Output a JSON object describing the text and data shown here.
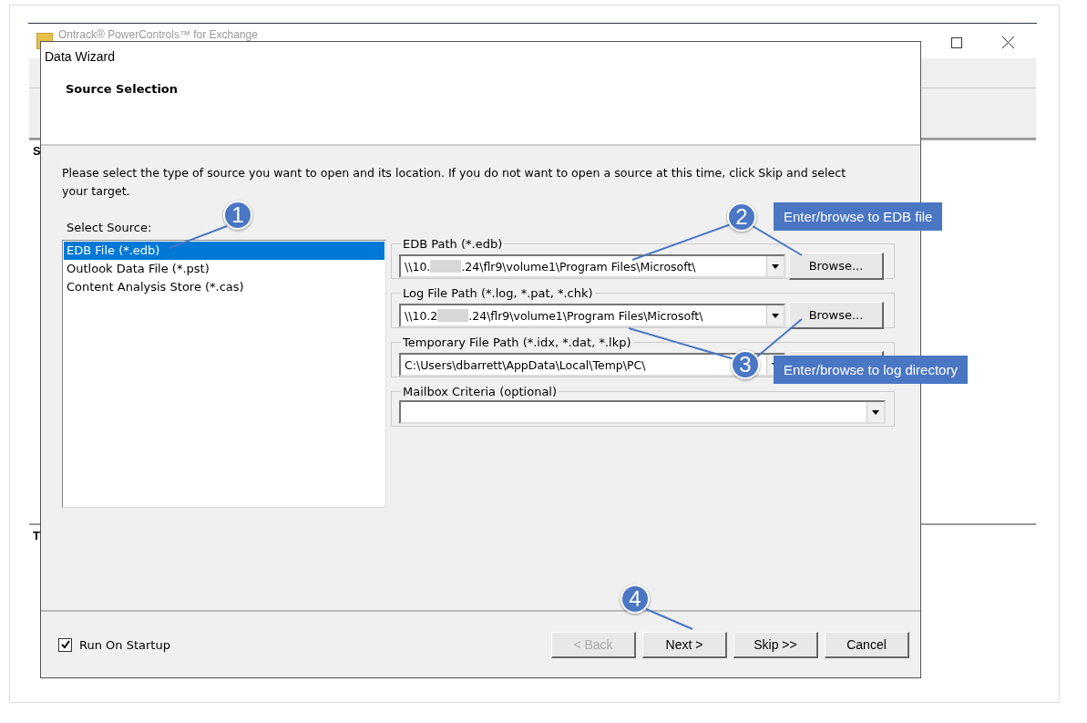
{
  "app_window": {
    "title": "Ontrack® PowerControls™ for Exchange",
    "pane_headers": [
      "S",
      "T"
    ]
  },
  "dialog": {
    "title": "Data Wizard",
    "heading": "Source Selection",
    "instructions": "Please select the type of source you want to open and its location. If you do not want to open a source at this time, click Skip and select your target.",
    "source_label": "Select Source:",
    "sources": [
      {
        "label": "EDB File (*.edb)",
        "selected": true
      },
      {
        "label": "Outlook Data File (*.pst)",
        "selected": false
      },
      {
        "label": "Content Analysis Store (*.cas)",
        "selected": false
      }
    ],
    "groups": [
      {
        "label": "EDB Path (*.edb)",
        "value": "\\\\10.",
        "redacted": true,
        "value_after": ".24\\flr9\\volume1\\Program Files\\Microsoft\\",
        "button": "Browse..."
      },
      {
        "label": "Log File Path (*.log, *.pat, *.chk)",
        "value": "\\\\10.2",
        "redacted": true,
        "value_after": ".24\\flr9\\volume1\\Program Files\\Microsoft\\",
        "button": "Browse..."
      },
      {
        "label": "Temporary File Path (*.idx, *.dat, *.lkp)",
        "value": "C:\\Users\\dbarrett\\AppData\\Local\\Temp\\PC\\",
        "redacted": false,
        "button_covered": true
      },
      {
        "label": "Mailbox Criteria (optional)",
        "redacted": false
      }
    ],
    "run_on_startup": {
      "label": "Run On Startup",
      "checked": true
    },
    "buttons": [
      {
        "label": "< Back",
        "disabled": true
      },
      {
        "label": "Next >",
        "disabled": false
      },
      {
        "label": "Skip >>",
        "disabled": false
      },
      {
        "label": "Cancel",
        "disabled": false
      }
    ]
  },
  "callouts": [
    {
      "number": "1"
    },
    {
      "number": "2",
      "note": "Enter/browse to EDB file"
    },
    {
      "number": "3",
      "note": "Enter/browse to log directory"
    },
    {
      "number": "4"
    }
  ]
}
